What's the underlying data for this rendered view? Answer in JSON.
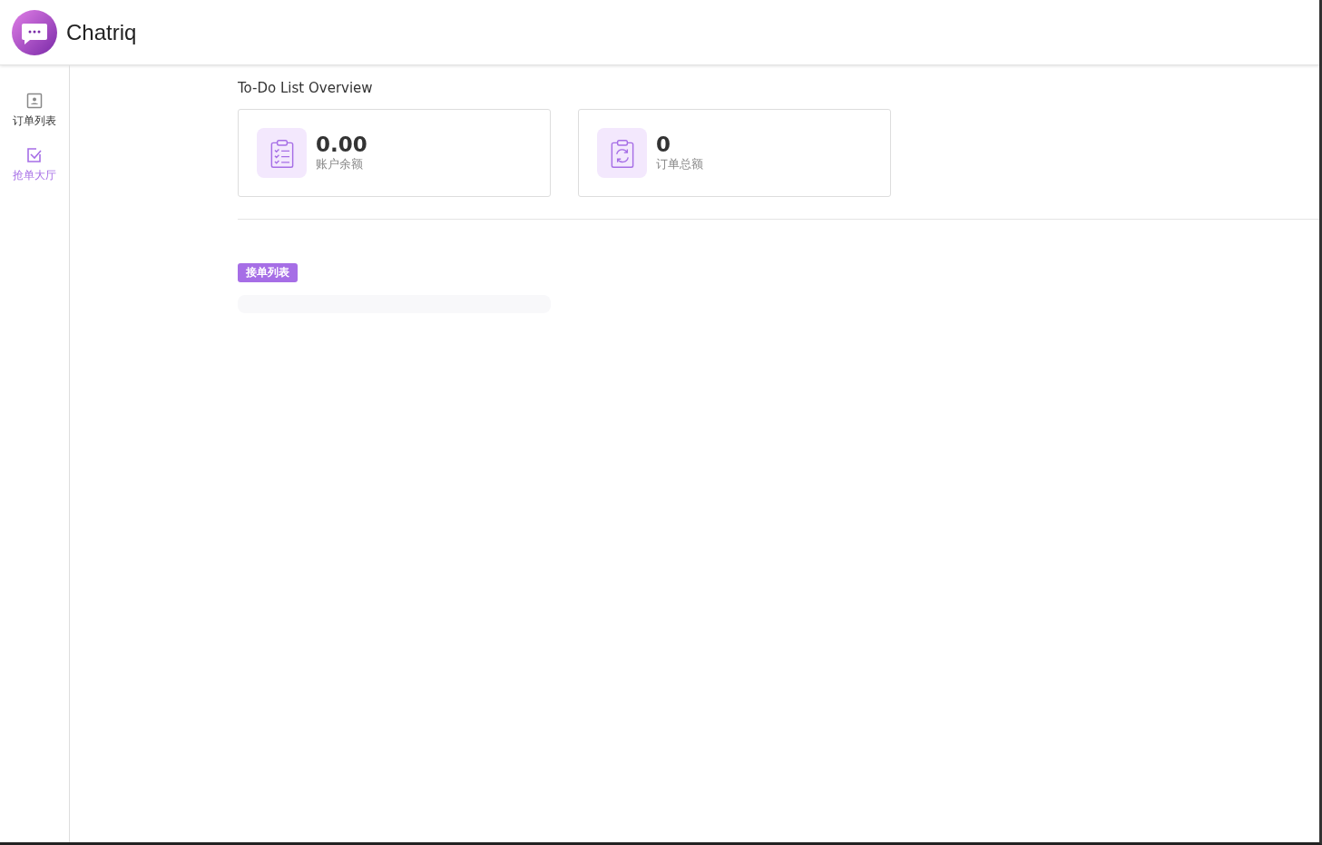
{
  "header": {
    "app_name": "Chatriq"
  },
  "sidebar": {
    "items": [
      {
        "label": "订单列表",
        "selected": false
      },
      {
        "label": "抢单大厅",
        "selected": true
      }
    ]
  },
  "overview": {
    "title": "To-Do List Overview",
    "cards": [
      {
        "value": "0.00",
        "label": "账户余额"
      },
      {
        "value": "0",
        "label": "订单总额"
      }
    ]
  },
  "section": {
    "tag": "接单列表"
  }
}
